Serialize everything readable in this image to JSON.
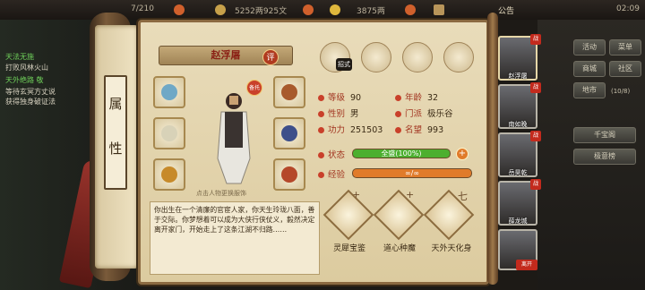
{
  "topbar": {
    "stamina": "7/210",
    "money": "5252两925文",
    "gold": "3875两",
    "announce": "公告",
    "time": "02:09"
  },
  "quest_log": {
    "lines": [
      "天法无施",
      "打败风林火山",
      "天外绝路 敬",
      "等待玄冥方丈说",
      "获得独身破证法"
    ]
  },
  "right_menu": {
    "buttons": [
      "活动",
      "菜单",
      "商城",
      "社区",
      "地市",
      "千宝阁",
      "极意榜"
    ],
    "level_note": "(10/8)"
  },
  "scroll": {
    "label_top": "属",
    "label_bottom": "性"
  },
  "character": {
    "name": "赵浮屠",
    "eval_badge": "评",
    "swap_badge": "备托",
    "click_hint": "点击人物更换服饰",
    "stats": {
      "level_label": "等级",
      "level": "90",
      "age_label": "年龄",
      "age": "32",
      "gender_label": "性别",
      "gender": "男",
      "sect_label": "门派",
      "sect": "极乐谷",
      "power_label": "功力",
      "power": "251503",
      "fame_label": "名望",
      "fame": "993",
      "status_label": "状态",
      "status": "全盛(100%)",
      "exp_label": "经验",
      "exp": "∞/∞"
    },
    "status_percent": 100,
    "bio": "你出生在一个清廉的官宦人家，你天生玲珑八面，善于交际。你梦想着可以成为大侠行侠仗义，毅然决定离开家门，开始走上了这条江湖不归路……",
    "tab_badge": "招式"
  },
  "skills": [
    {
      "name": "灵犀宝鉴",
      "mark": "+"
    },
    {
      "name": "道心种魔",
      "mark": "+"
    },
    {
      "name": "天外天化身",
      "mark": "七"
    }
  ],
  "party": [
    {
      "name": "赵浮屠",
      "flag": "战"
    },
    {
      "name": "南如晚",
      "flag": "战"
    },
    {
      "name": "岳昊乾",
      "flag": "战"
    },
    {
      "name": "薛龙城",
      "flag": "战"
    },
    {
      "name": "",
      "flag": "离开"
    }
  ],
  "colors": {
    "accent": "#a1331f",
    "status_bar": "#4caf2f",
    "exp_bar": "#e07b2a"
  }
}
